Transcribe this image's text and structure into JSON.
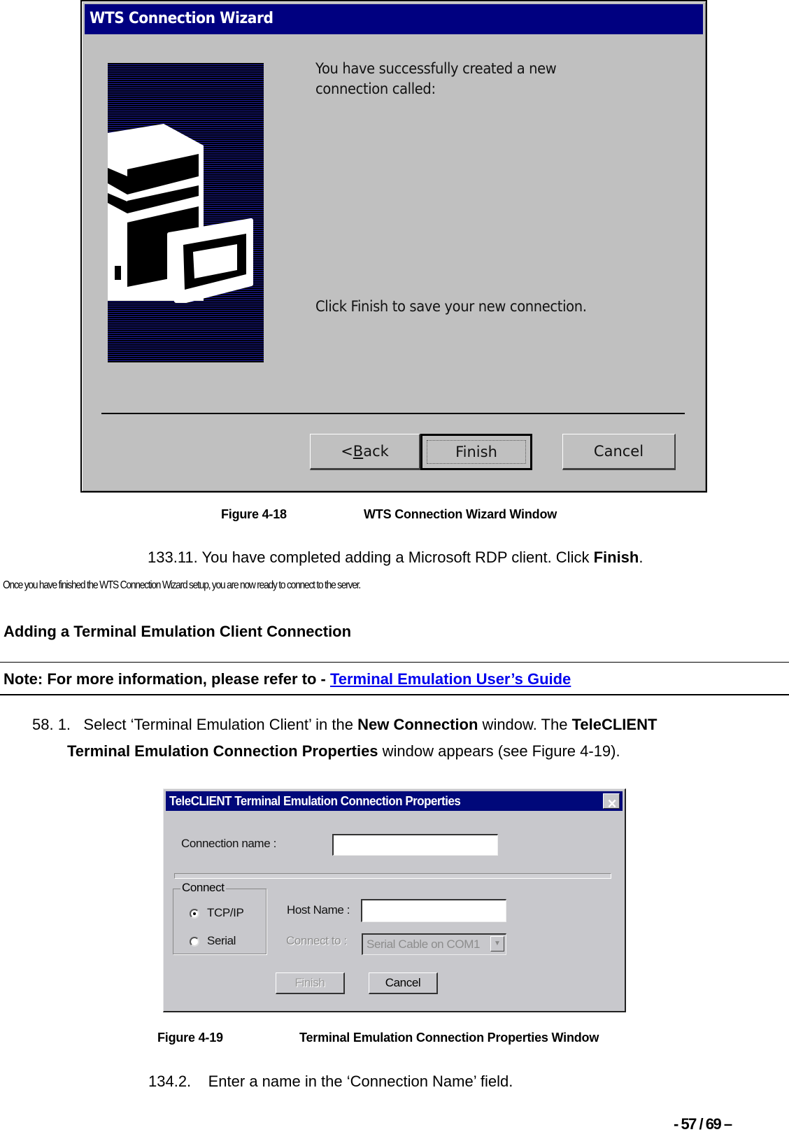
{
  "wizard": {
    "title": "WTS Connection Wizard",
    "message_line1": "You have successfully created a new",
    "message_line2": "connection called:",
    "instruction": "Click Finish to save your new connection.",
    "buttons": {
      "back_prefix": "<",
      "back_mnemonic": "B",
      "back_rest": "ack",
      "finish": "Finish",
      "cancel": "Cancel"
    },
    "art_icon": "computer-with-terminal-icon"
  },
  "figure_18": {
    "number": "Figure 4-18",
    "title": "WTS Connection Wizard Window"
  },
  "step_133_11": {
    "number": "133.11.",
    "text": "You have completed adding a Microsoft RDP client.  Click ",
    "bold": "Finish",
    "end": "."
  },
  "completion_note": "Once you have finished the WTS  Connection Wizard setup, you are now ready to connect to the server.",
  "section_heading": "Adding a Terminal Emulation Client Connection",
  "note": {
    "prefix": "Note:  For more information, please refer to - ",
    "link_text": "Terminal Emulation User’s Guide",
    "link_color": "#0000ee"
  },
  "step_58_1": {
    "number": "58. 1.",
    "t1": "Select ‘Terminal Emulation Client’ in the ",
    "b1": "New Connection",
    "t2": " window.   The ",
    "b2": "TeleCLIENT",
    "b3": "Terminal Emulation Connection Properties",
    "t3": " window appears (see Figure 4-19)."
  },
  "teleclient_dialog": {
    "title": "TeleCLIENT Terminal Emulation Connection Properties",
    "close_glyph": "✕",
    "connection_name_label": "Connection name :",
    "connection_name_value": "",
    "connect_group_label": "Connect",
    "radio_options": [
      {
        "label": "TCP/IP",
        "checked": true
      },
      {
        "label": "Serial",
        "checked": false
      }
    ],
    "host_name_label": "Host Name :",
    "host_name_value": "",
    "connect_to_label": "Connect to :",
    "connect_to_value": "Serial Cable on COM1",
    "finish_label": "Finish",
    "cancel_label": "Cancel"
  },
  "figure_19": {
    "number": "Figure 4-19",
    "title": "Terminal Emulation Connection Properties Window"
  },
  "step_134_2": {
    "number": "134.2.",
    "text": "Enter a name in the ‘Connection Name’ field."
  },
  "page_number": "- 57 / 69 –",
  "colors": {
    "titlebar_blue": "#000080",
    "dialog_gray": "#c0c0c0"
  }
}
